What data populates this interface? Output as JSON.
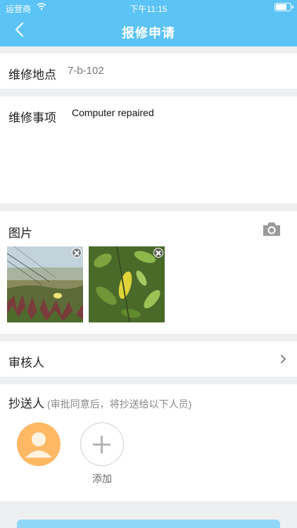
{
  "status_bar": {
    "carrier": "运营商",
    "time": "下午11:15",
    "battery_level": 0.8
  },
  "header": {
    "title": "报修申请"
  },
  "location": {
    "label": "维修地点",
    "value": "7-b-102"
  },
  "issue": {
    "label": "维修事项",
    "value": "Computer repaired"
  },
  "photos": {
    "label": "图片"
  },
  "reviewer": {
    "label": "审核人"
  },
  "cc": {
    "label": "抄送人",
    "hint": "(审批同意后，将抄送给以下人员)",
    "add_label": "添加"
  },
  "colors": {
    "accent": "#5bc3f5",
    "avatar": "#ffb864"
  }
}
